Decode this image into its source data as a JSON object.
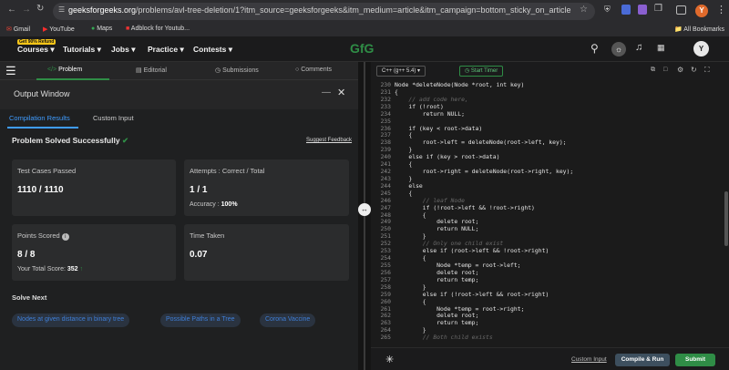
{
  "browser": {
    "url_host": "geeksforgeeks.org",
    "url_path": "/problems/avl-tree-deletion/1?itm_source=geeksforgeeks&itm_medium=article&itm_campaign=bottom_sticky_on_article",
    "bookmarks": [
      "Gmail",
      "YouTube",
      "Maps",
      "Adblock for Youtub..."
    ],
    "all_bookmarks": "All Bookmarks",
    "profile_initial": "Y"
  },
  "site": {
    "sale_badge": "Get 90% Refund",
    "nav": [
      "Courses",
      "Tutorials",
      "Jobs",
      "Practice",
      "Contests"
    ],
    "logo": "GfG",
    "avatar": "Y"
  },
  "left_tabs": [
    "Problem",
    "Editorial",
    "Submissions",
    "Comments"
  ],
  "output": {
    "title": "Output Window",
    "subtabs": [
      "Compilation Results",
      "Custom Input"
    ],
    "status": "Problem Solved Successfully",
    "suggest": "Suggest Feedback",
    "cards": {
      "tests_label": "Test Cases Passed",
      "tests_value": "1110 / 1110",
      "attempts_label": "Attempts : Correct / Total",
      "attempts_value": "1 / 1",
      "accuracy_label": "Accuracy :",
      "accuracy_value": "100%",
      "points_label": "Points Scored",
      "points_value": "8 / 8",
      "total_label": "Your Total Score:",
      "total_value": "352",
      "time_label": "Time Taken",
      "time_value": "0.07"
    },
    "solve_next": "Solve Next",
    "next_items": [
      "Nodes at given distance in binary tree",
      "Possible Paths in a Tree",
      "Corona Vaccine"
    ]
  },
  "editor": {
    "language": "C++ (g++ 5.4)",
    "timer": "Start Timer",
    "lines": [
      {
        "n": "230",
        "t": "Node *deleteNode(Node *root, int key)"
      },
      {
        "n": "231",
        "t": "{"
      },
      {
        "n": "232",
        "t": "    // add code here,"
      },
      {
        "n": "233",
        "t": "    if (!root)"
      },
      {
        "n": "234",
        "t": "        return NULL;"
      },
      {
        "n": "235",
        "t": ""
      },
      {
        "n": "236",
        "t": "    if (key < root->data)"
      },
      {
        "n": "237",
        "t": "    {"
      },
      {
        "n": "238",
        "t": "        root->left = deleteNode(root->left, key);"
      },
      {
        "n": "239",
        "t": "    }"
      },
      {
        "n": "240",
        "t": "    else if (key > root->data)"
      },
      {
        "n": "241",
        "t": "    {"
      },
      {
        "n": "242",
        "t": "        root->right = deleteNode(root->right, key);"
      },
      {
        "n": "243",
        "t": "    }"
      },
      {
        "n": "244",
        "t": "    else"
      },
      {
        "n": "245",
        "t": "    {"
      },
      {
        "n": "246",
        "t": "        // leaf Node"
      },
      {
        "n": "247",
        "t": "        if (!root->left && !root->right)"
      },
      {
        "n": "248",
        "t": "        {"
      },
      {
        "n": "249",
        "t": "            delete root;"
      },
      {
        "n": "250",
        "t": "            return NULL;"
      },
      {
        "n": "251",
        "t": "        }"
      },
      {
        "n": "252",
        "t": "        // Only one child exist"
      },
      {
        "n": "253",
        "t": "        else if (root->left && !root->right)"
      },
      {
        "n": "254",
        "t": "        {"
      },
      {
        "n": "255",
        "t": "            Node *temp = root->left;"
      },
      {
        "n": "256",
        "t": "            delete root;"
      },
      {
        "n": "257",
        "t": "            return temp;"
      },
      {
        "n": "258",
        "t": "        }"
      },
      {
        "n": "259",
        "t": "        else if (!root->left && root->right)"
      },
      {
        "n": "260",
        "t": "        {"
      },
      {
        "n": "261",
        "t": "            Node *temp = root->right;"
      },
      {
        "n": "262",
        "t": "            delete root;"
      },
      {
        "n": "263",
        "t": "            return temp;"
      },
      {
        "n": "264",
        "t": "        }"
      },
      {
        "n": "265",
        "t": "        // Both child exists"
      }
    ],
    "custom_input": "Custom Input",
    "compile": "Compile & Run",
    "submit": "Submit"
  },
  "colors": {
    "accent_green": "#2f8d46",
    "link_blue": "#3f7fd8"
  }
}
